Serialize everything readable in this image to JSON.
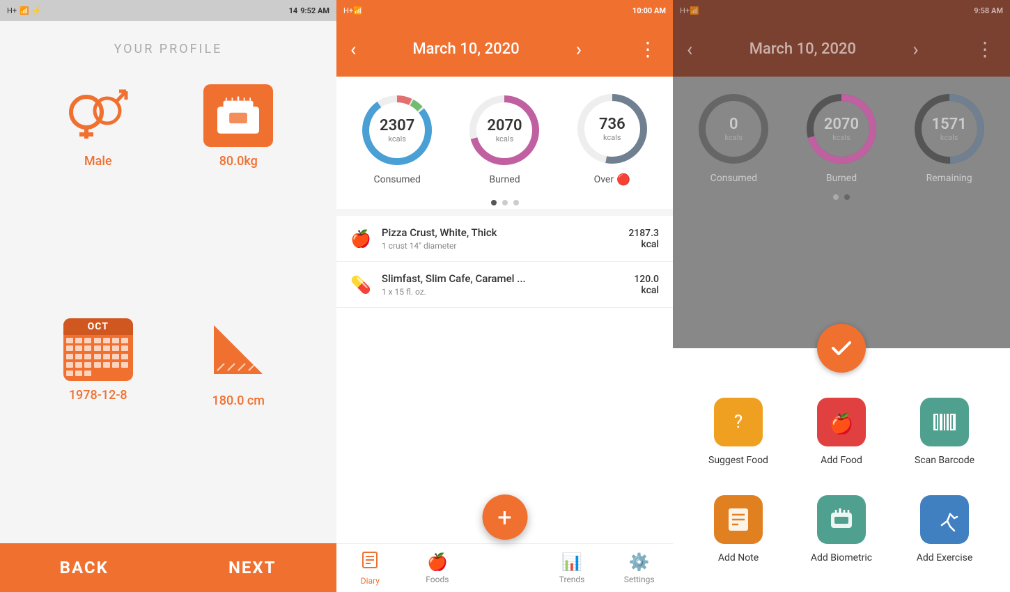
{
  "screen1": {
    "status_bar": {
      "time": "9:52 AM",
      "signal": "H+",
      "notifications": "14"
    },
    "title": "YOUR PROFILE",
    "items": [
      {
        "id": "gender",
        "label": "Male",
        "icon": "gender"
      },
      {
        "id": "weight",
        "label": "80.0kg",
        "icon": "scale"
      },
      {
        "id": "birthday",
        "label": "1978-12-8",
        "icon": "calendar"
      },
      {
        "id": "height",
        "label": "180.0 cm",
        "icon": "height"
      }
    ],
    "buttons": [
      {
        "id": "back",
        "label": "BACK"
      },
      {
        "id": "next",
        "label": "NEXT"
      }
    ]
  },
  "screen2": {
    "status_bar": {
      "time": "10:00 AM"
    },
    "header": {
      "date": "March 10, 2020",
      "prev_label": "‹",
      "next_label": "›",
      "menu_label": "⋮"
    },
    "rings": [
      {
        "id": "consumed",
        "value": "2307",
        "unit": "kcals",
        "label": "Consumed",
        "color": "#4a9fd4",
        "pct": 92
      },
      {
        "id": "burned",
        "value": "2070",
        "unit": "kcals",
        "label": "Burned",
        "color": "#c060a0",
        "pct": 85
      },
      {
        "id": "over",
        "value": "736",
        "unit": "kcals",
        "label": "Over",
        "warning": "🔴",
        "color": "#708090",
        "pct": 60
      }
    ],
    "food_items": [
      {
        "icon": "🍎",
        "name": "Pizza Crust, White, Thick",
        "detail": "1 crust 14\" diameter",
        "calories": "2187.3",
        "unit": "kcal"
      },
      {
        "icon": "💊",
        "name": "Slimfast, Slim Cafe, Caramel ...",
        "detail": "1 x 15 fl. oz.",
        "calories": "120.0",
        "unit": "kcal"
      }
    ],
    "nav": [
      {
        "id": "diary",
        "label": "Diary",
        "icon": "📓",
        "active": true
      },
      {
        "id": "foods",
        "label": "Foods",
        "icon": "🍎",
        "active": false
      },
      {
        "id": "add",
        "label": "+",
        "icon": "+",
        "active": false
      },
      {
        "id": "trends",
        "label": "Trends",
        "icon": "📊",
        "active": false
      },
      {
        "id": "settings",
        "label": "Settings",
        "icon": "⚙️",
        "active": false
      }
    ],
    "fab_label": "+"
  },
  "screen3": {
    "status_bar": {
      "time": "9:58 AM"
    },
    "header": {
      "date": "March 10, 2020",
      "prev_label": "‹",
      "next_label": "›",
      "menu_label": "⋮"
    },
    "rings": [
      {
        "id": "consumed",
        "value": "0",
        "unit": "kcals",
        "label": "Consumed",
        "color": "#888",
        "pct": 0
      },
      {
        "id": "burned",
        "value": "2070",
        "unit": "kcals",
        "label": "Burned",
        "color": "#c060a0",
        "pct": 85
      },
      {
        "id": "remaining",
        "value": "1571",
        "unit": "kcals",
        "label": "Remaining",
        "color": "#708090",
        "pct": 55
      }
    ],
    "menu_items": [
      {
        "id": "suggest-food",
        "label": "Suggest Food",
        "icon": "❓",
        "color": "yellow"
      },
      {
        "id": "add-food",
        "label": "Add Food",
        "icon": "🍎",
        "color": "red"
      },
      {
        "id": "scan-barcode",
        "label": "Scan Barcode",
        "icon": "barcode",
        "color": "teal"
      },
      {
        "id": "add-note",
        "label": "Add Note",
        "icon": "note",
        "color": "gold"
      },
      {
        "id": "add-biometric",
        "label": "Add Biometric",
        "icon": "biometric",
        "color": "teal"
      },
      {
        "id": "add-exercise",
        "label": "Add Exercise",
        "icon": "exercise",
        "color": "blue"
      }
    ]
  }
}
